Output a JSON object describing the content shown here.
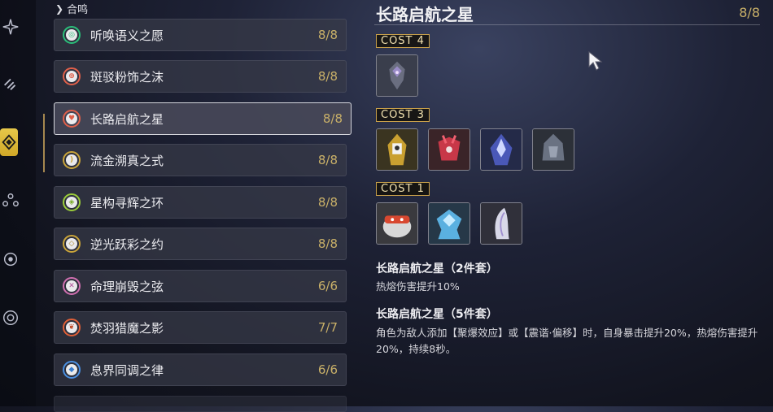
{
  "section_header": "合鸣",
  "sets": [
    {
      "name": "听唤语义之愿",
      "count": "8/8",
      "color": "#2bbf7a"
    },
    {
      "name": "斑驳粉饰之沫",
      "count": "8/8",
      "color": "#e0604a"
    },
    {
      "name": "长路启航之星",
      "count": "8/8",
      "color": "#e0604a",
      "selected": true
    },
    {
      "name": "流金溯真之式",
      "count": "8/8",
      "color": "#c9a43a"
    },
    {
      "name": "星构寻辉之环",
      "count": "8/8",
      "color": "#9acb3a"
    },
    {
      "name": "逆光跃彩之约",
      "count": "8/8",
      "color": "#c9a43a"
    },
    {
      "name": "命理崩毁之弦",
      "count": "6/6",
      "color": "#d070b0"
    },
    {
      "name": "焚羽猎魔之影",
      "count": "7/7",
      "color": "#e06038"
    },
    {
      "name": "息界同调之律",
      "count": "6/6",
      "color": "#4a8fe0"
    }
  ],
  "detail": {
    "title": "长路启航之星",
    "count": "8/8",
    "cost_groups": [
      {
        "label": "COST 4",
        "echo_count": 1
      },
      {
        "label": "COST 3",
        "echo_count": 4
      },
      {
        "label": "COST 1",
        "echo_count": 3
      }
    ],
    "bonus_2_title": "长路启航之星（2件套）",
    "bonus_2_desc": "热熔伤害提升10%",
    "bonus_5_title": "长路启航之星（5件套）",
    "bonus_5_desc": "角色为敌人添加【聚爆效应】或【震谐·偏移】时，自身暴击提升20%，热熔伤害提升20%，持续8秒。"
  },
  "rail_icons": [
    "resonator-icon",
    "weapon-icon",
    "echo-icon",
    "team-icon",
    "target-icon",
    "gear-wheel-icon"
  ],
  "accent_color": "#c9b068"
}
